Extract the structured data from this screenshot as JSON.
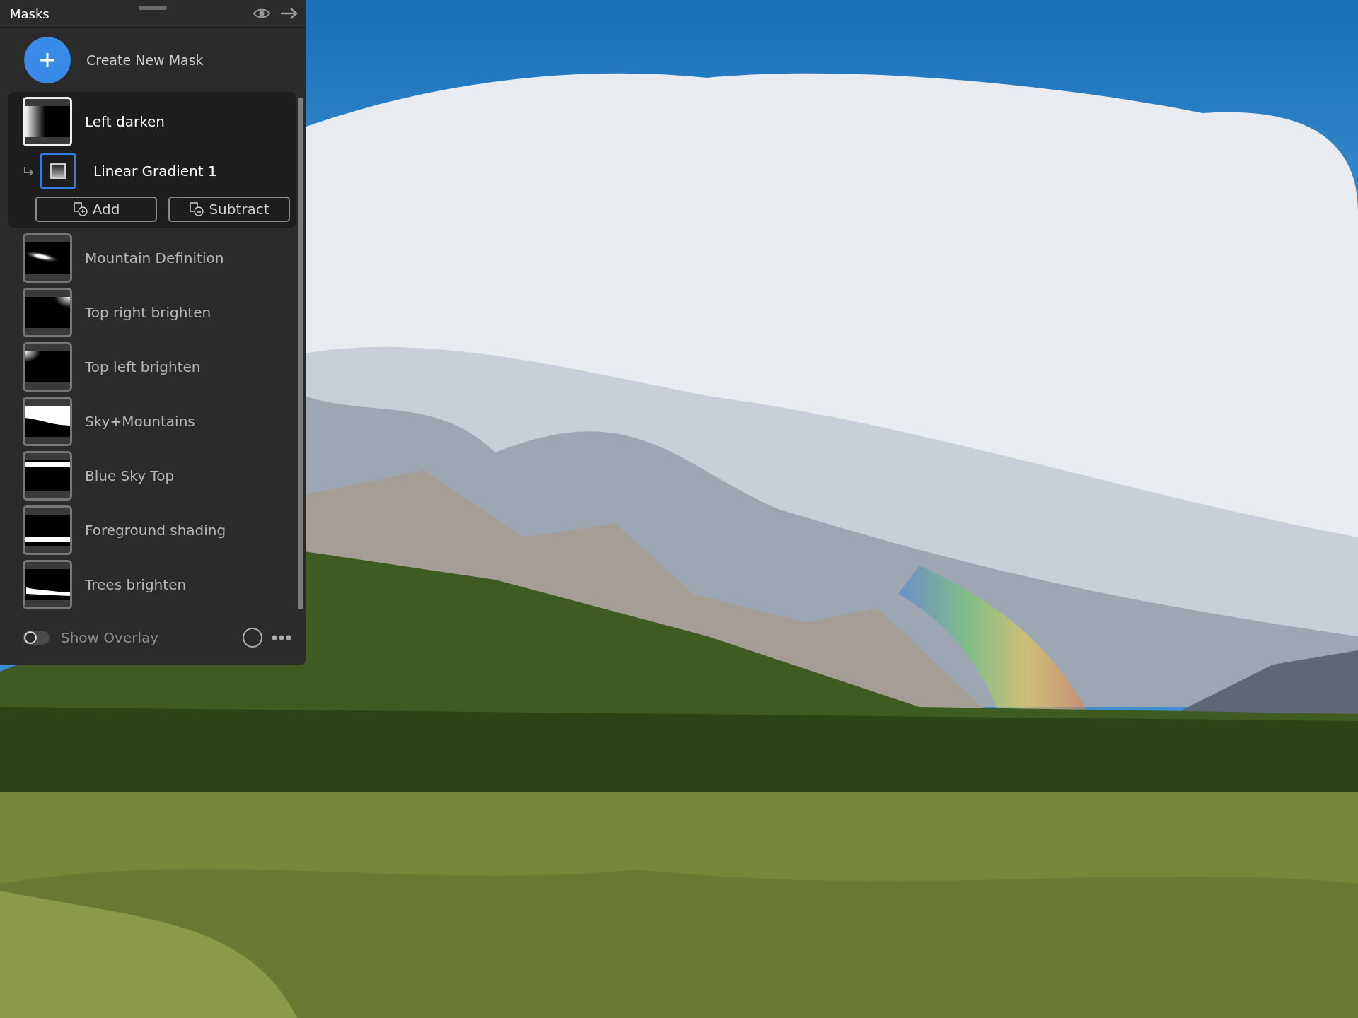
{
  "panel": {
    "title": "Masks"
  },
  "create_button": {
    "label": "Create New Mask"
  },
  "masks": [
    {
      "name": "Left darken",
      "kind": "gradient-left",
      "selected": true,
      "expanded": true,
      "components": [
        {
          "name": "Linear Gradient 1",
          "selected": true
        }
      ],
      "actions": [
        {
          "kind": "add",
          "label": "Add"
        },
        {
          "kind": "subtract",
          "label": "Subtract"
        }
      ]
    },
    {
      "name": "Mountain Definition",
      "kind": "ellipse",
      "selected": false,
      "expanded": false
    },
    {
      "name": "Top right brighten",
      "kind": "corner-right",
      "selected": false,
      "expanded": false
    },
    {
      "name": "Top left brighten",
      "kind": "corner-left",
      "selected": false,
      "expanded": false
    },
    {
      "name": "Sky+Mountains",
      "kind": "sky",
      "selected": false,
      "expanded": false
    },
    {
      "name": "Blue Sky Top",
      "kind": "band-top",
      "selected": false,
      "expanded": false
    },
    {
      "name": "Foreground shading",
      "kind": "band-bottom",
      "selected": false,
      "expanded": false
    },
    {
      "name": "Trees brighten",
      "kind": "trees",
      "selected": false,
      "expanded": false
    }
  ],
  "footer": {
    "overlay_label": "Show Overlay",
    "on": false
  }
}
